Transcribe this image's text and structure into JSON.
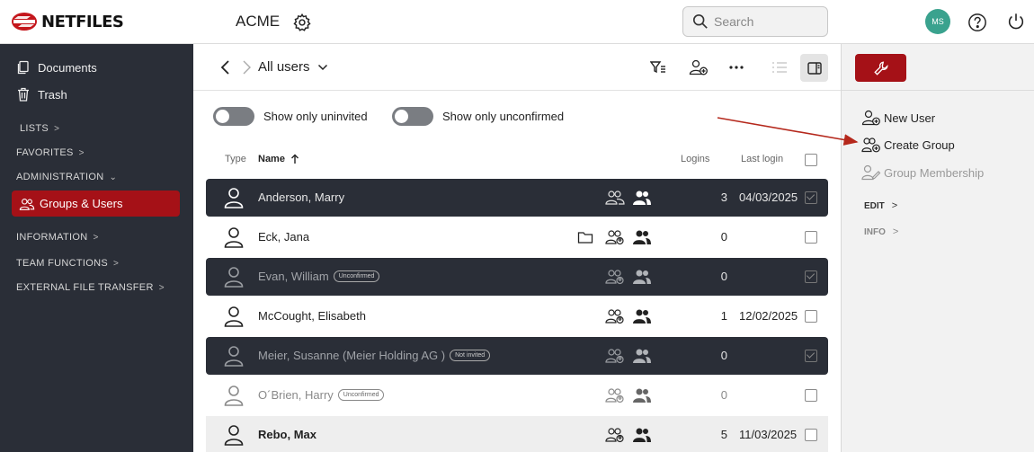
{
  "header": {
    "logo_text": "NETFILES",
    "company": "ACME",
    "search_placeholder": "Search",
    "avatar_initials": "MS"
  },
  "sidebar": {
    "documents": "Documents",
    "trash": "Trash",
    "lists": "LISTS",
    "favorites": "FAVORITES",
    "administration": "ADMINISTRATION",
    "groups_users": "Groups & Users",
    "information": "INFORMATION",
    "team_functions": "TEAM FUNCTIONS",
    "external_file_transfer": "EXTERNAL FILE TRANSFER"
  },
  "main": {
    "view_title": "All users",
    "toggle_uninvited": "Show only uninvited",
    "toggle_unconfirmed": "Show only unconfirmed",
    "columns": {
      "type": "Type",
      "name": "Name",
      "logins": "Logins",
      "last_login": "Last login"
    },
    "rows": [
      {
        "name": "Anderson, Marry",
        "badge": "",
        "logins": "3",
        "last_login": "04/03/2025"
      },
      {
        "name": "Eck, Jana",
        "badge": "",
        "logins": "0",
        "last_login": ""
      },
      {
        "name": "Evan, William",
        "badge": "Unconfirmed",
        "logins": "0",
        "last_login": ""
      },
      {
        "name": "McCought, Elisabeth",
        "badge": "",
        "logins": "1",
        "last_login": "12/02/2025"
      },
      {
        "name": "Meier, Susanne (Meier Holding AG )",
        "badge": "Not invited",
        "logins": "0",
        "last_login": ""
      },
      {
        "name": "O´Brien, Harry",
        "badge": "Unconfirmed",
        "logins": "0",
        "last_login": ""
      },
      {
        "name": "Rebo, Max",
        "badge": "",
        "logins": "5",
        "last_login": "11/03/2025"
      }
    ]
  },
  "right_panel": {
    "new_user": "New User",
    "create_group": "Create Group",
    "group_membership": "Group Membership",
    "edit": "EDIT",
    "info": "INFO"
  },
  "colors": {
    "brand_red": "#a51117",
    "sidebar_bg": "#2a2e37",
    "avatar": "#3aa28e",
    "arrow": "#b5281c"
  }
}
